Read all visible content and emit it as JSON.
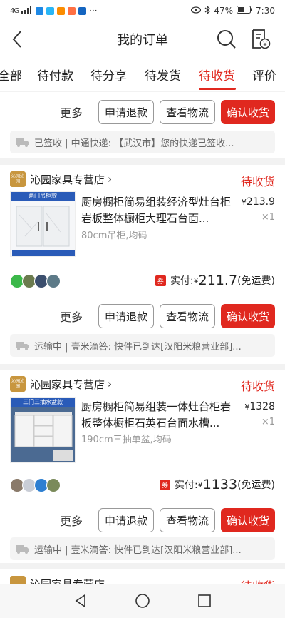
{
  "statusbar": {
    "network": "4G",
    "battery": "47%",
    "time": "7:30"
  },
  "header": {
    "title": "我的订单"
  },
  "tabs": [
    {
      "label": "全部"
    },
    {
      "label": "待付款"
    },
    {
      "label": "待分享"
    },
    {
      "label": "待发货"
    },
    {
      "label": "待收货"
    },
    {
      "label": "评价"
    }
  ],
  "active_tab": "待收货",
  "buttons": {
    "more": "更多",
    "refund": "申请退款",
    "logistics": "查看物流",
    "confirm": "确认收货"
  },
  "card0": {
    "logistics_text": "已签收 | 中通快递: 【武汉市】您的快递已签收..."
  },
  "orders": [
    {
      "shop": "沁园家具专营店",
      "shop_logo": "沁园沁园",
      "status": "待收货",
      "thumb_label": "两门吊柜款",
      "title": "厨房橱柜简易组装经济型灶台柜岩板整体橱柜大理石台面...",
      "spec": "80cm吊柜,均码",
      "price_symbol": "¥",
      "price": "213.9",
      "qty": "×1",
      "paid_label": "实付:",
      "paid_symbol": "¥",
      "paid_amount": "211.7",
      "shipping": "(免运费)",
      "coupon": "券",
      "logistics_text": "运输中 | 壹米滴答: 快件已到达[汉阳米粮营业部]..."
    },
    {
      "shop": "沁园家具专营店",
      "shop_logo": "沁园沁园",
      "status": "待收货",
      "thumb_label": "三门三抽水盆款",
      "title": "厨房橱柜简易组装一体灶台柜岩板整体橱柜石英石台面水槽...",
      "spec": "190cm三抽单盆,均码",
      "price_symbol": "¥",
      "price": "1328",
      "qty": "×1",
      "paid_label": "实付:",
      "paid_symbol": "¥",
      "paid_amount": "1133",
      "shipping": "(免运费)",
      "coupon": "券",
      "logistics_text": "运输中 | 壹米滴答: 快件已到达[汉阳米粮营业部]..."
    },
    {
      "shop": "沁园家具专营店",
      "status": "待收货"
    }
  ],
  "colors": {
    "accent": "#e0281f",
    "shop_logo": "#c8963e"
  }
}
